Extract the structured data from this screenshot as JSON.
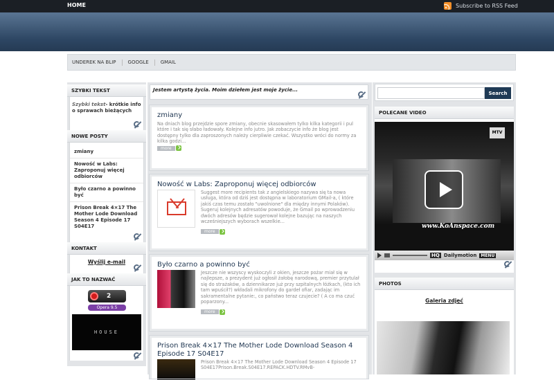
{
  "topbar": {
    "home_label": "HOME",
    "rss_label": "Subscribe to RSS Feed"
  },
  "nav": {
    "items": [
      "UNDEREK NA BLIP",
      "GOOGLE",
      "GMAIL"
    ]
  },
  "left": {
    "quick": {
      "title": "SZYBKI TEKST",
      "text_italic": "Szybki tekst",
      "text_rest": "- krótkie info o sprawach bieżących"
    },
    "recent": {
      "title": "NOWE POSTY",
      "items": [
        "zmiany",
        "Nowość w Labs: Zaproponuj więcej odbiorców",
        "Było czarno a powinno być",
        "Prison Break 4×17 The Mother Lode Download Season 4 Episode 17 S04E17"
      ]
    },
    "contact": {
      "title": "KONTAKT",
      "link": "Wyślij e-mail"
    },
    "howto": {
      "title": "JAK TO NAZWAĆ",
      "counter": "2",
      "browser": "Opera 9.5",
      "video_label": "HOUSE"
    }
  },
  "mid": {
    "motto": "Jestem artystą życia. Moim dziełem jest moje życie...",
    "more_label": "more",
    "posts": [
      {
        "title": "zmiany",
        "text": "Na dniach blog przejdzie spore zmiany, obecnie skasowałem tylko kilka kategorii i pul które i tak się słabo ładowały. Kolejne info jutro. Jak zobaczycie info że blog jest dostępny tylko dla zaproszonych należy cierpliwie czekać. Wszystko wróci do normy za kilka godzi..."
      },
      {
        "title": "Nowość w Labs: Zaproponuj więcej odbiorców",
        "text": "Suggest more recipients tak z angielskiego nazywa się ta nowa usługa, która od dziś jest dostępna w laboratorium GMail-a, ( które jakiś czas temu zostało \"uwolnione\" dla między innymi Polaków). Sugeruj kolejnych adresatów powoduje, że Gmail po wprowadzeniu dwóch adresów będzie sugerował kolejne bazując na naszych wcześniejszych wyborach wszelkie..."
      },
      {
        "title": "Było czarno a powinno być",
        "text": "Jeszcze nie wszyscy wyskoczyli z okien, jeszcze pożar miał się w najlepsze, a prezydent już ogłosił żałobę narodową, premier przytulał się do strażaków, a dziennikarze już przy szpitalnych łóżkach, (kto ich tam wpuścił?) wkładali mikrofony do gardeł ofiar, zadając im sakramentalne pytanie:, co państwo teraz czujecie? ( A co ma czuć poparzony..."
      },
      {
        "title": "Prison Break 4×17 The Mother Lode Download Season 4 Episode 17 S04E17",
        "text": "Prison Break 4×17 The Mother Lode Download Season 4 Episode 17 S04E17Prison.Break.S04E17.REPACK.HDTV.RMvB-"
      }
    ]
  },
  "right": {
    "search_button": "Search",
    "search_placeholder": "",
    "video": {
      "title": "POLECANE VIDEO",
      "watermark": "www.KoAnspace.com",
      "brand": "Dailymotion",
      "menu": "MENU",
      "hq": "HQ",
      "mtv": "MTV"
    },
    "photos": {
      "title": "PHOTOS",
      "link": "Galeria zdjęć"
    }
  },
  "colors": {
    "header": "#2d4663",
    "title": "#1e3550",
    "topbar": "#1b1f25",
    "rss": "#f3902b"
  }
}
